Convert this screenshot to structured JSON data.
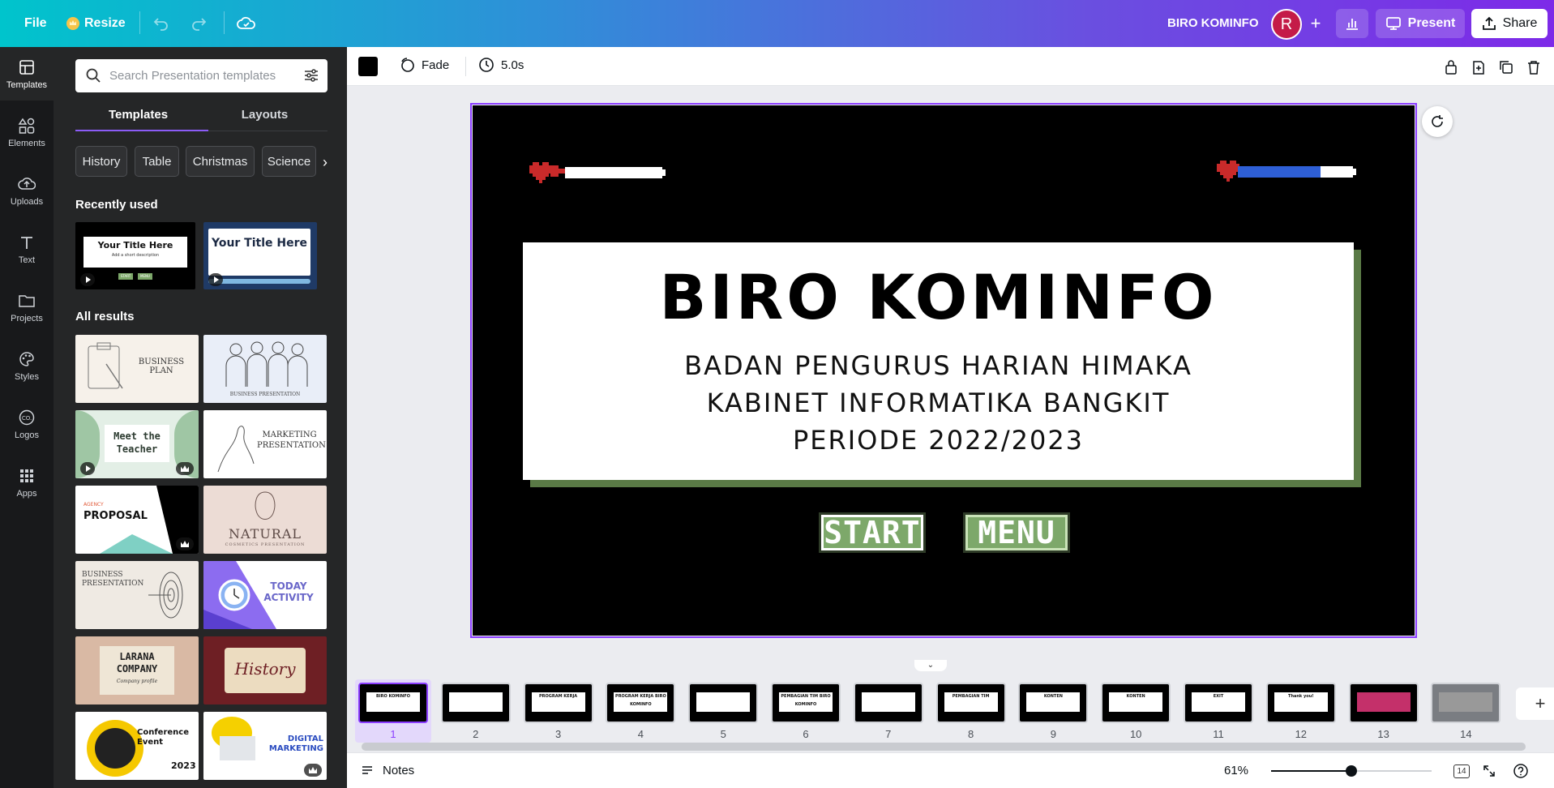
{
  "topbar": {
    "file": "File",
    "resize": "Resize",
    "doc_title": "BIRO KOMINFO",
    "avatar_initial": "R",
    "present": "Present",
    "share": "Share"
  },
  "rail": {
    "items": [
      {
        "label": "Templates",
        "icon": "templates-icon"
      },
      {
        "label": "Elements",
        "icon": "elements-icon"
      },
      {
        "label": "Uploads",
        "icon": "uploads-icon"
      },
      {
        "label": "Text",
        "icon": "text-icon"
      },
      {
        "label": "Projects",
        "icon": "folder-icon"
      },
      {
        "label": "Styles",
        "icon": "palette-icon"
      },
      {
        "label": "Logos",
        "icon": "logo-icon"
      },
      {
        "label": "Apps",
        "icon": "apps-icon"
      }
    ]
  },
  "panel": {
    "search_placeholder": "Search Presentation templates",
    "tabs": [
      "Templates",
      "Layouts"
    ],
    "chips": [
      "History",
      "Table",
      "Christmas",
      "Science"
    ],
    "recently_used": "Recently used",
    "all_results": "All results",
    "recent": [
      {
        "title": "Your Title Here",
        "subtitle": "Add a short description",
        "btn1": "START",
        "btn2": "MENU"
      },
      {
        "title": "Your Title Here"
      }
    ],
    "templates": [
      {
        "title": "BUSINESS PLAN"
      },
      {
        "title": "BUSINESS PRESENTATION"
      },
      {
        "title": "Meet the Teacher"
      },
      {
        "title": "MARKETING PRESENTATION"
      },
      {
        "title": "PROPOSAL",
        "kicker": "AGENCY"
      },
      {
        "title": "NATURAL",
        "sub": "COSMETICS PRESENTATION"
      },
      {
        "title": "BUSINESS PRESENTATION"
      },
      {
        "title": "TODAY ACTIVITY"
      },
      {
        "title": "LARANA COMPANY",
        "sub": "Company profile"
      },
      {
        "title": "History"
      },
      {
        "title": "Conference Event",
        "year": "2023"
      },
      {
        "title": "DIGITAL MARKETING"
      }
    ]
  },
  "toolbar": {
    "transition": "Fade",
    "duration": "5.0s",
    "fill_color": "#000000"
  },
  "slide": {
    "title": "BIRO KOMINFO",
    "line1": "BADAN PENGURUS HARIAN HIMAKA",
    "line2": "KABINET INFORMATIKA BANGKIT",
    "line3": "PERIODE 2022/2023",
    "start": "START",
    "menu": "MENU",
    "accent_green": "#5a7a46",
    "button_green": "#7da86a"
  },
  "filmstrip": {
    "pages": [
      {
        "num": "1",
        "label": "BIRO KOMINFO",
        "selected": true
      },
      {
        "num": "2",
        "label": ""
      },
      {
        "num": "3",
        "label": "PROGRAM KERJA"
      },
      {
        "num": "4",
        "label": "PROGRAM KERJA BIRO KOMINFO"
      },
      {
        "num": "5",
        "label": ""
      },
      {
        "num": "6",
        "label": "PEMBAGIAN TIM BIRO KOMINFO"
      },
      {
        "num": "7",
        "label": ""
      },
      {
        "num": "8",
        "label": "PEMBAGIAN TIM"
      },
      {
        "num": "9",
        "label": "KONTEN"
      },
      {
        "num": "10",
        "label": "KONTEN"
      },
      {
        "num": "11",
        "label": "EXIT"
      },
      {
        "num": "12",
        "label": "Thank you!"
      },
      {
        "num": "13",
        "label": ""
      },
      {
        "num": "14",
        "label": ""
      }
    ]
  },
  "bottombar": {
    "notes": "Notes",
    "zoom": "61%",
    "zoom_level": 0.5,
    "page_count": "14"
  }
}
